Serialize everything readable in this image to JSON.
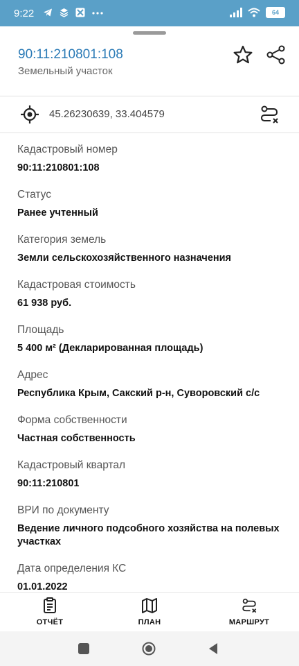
{
  "status_bar": {
    "time": "9:22",
    "left_icons": [
      "telegram-icon",
      "stack-icon",
      "app-icon",
      "more-dots-icon"
    ],
    "right_icons": [
      "signal-icon",
      "wifi-icon"
    ],
    "battery": "64"
  },
  "header": {
    "title": "90:11:210801:108",
    "subtitle": "Земельный участок"
  },
  "coordinates": "45.26230639, 33.404579",
  "details": [
    {
      "label": "Кадастровый номер",
      "value": "90:11:210801:108"
    },
    {
      "label": "Статус",
      "value": "Ранее учтенный"
    },
    {
      "label": "Категория земель",
      "value": "Земли сельскохозяйственного назначения"
    },
    {
      "label": "Кадастровая стоимость",
      "value": "61 938 руб."
    },
    {
      "label": "Площадь",
      "value": "5 400 м² (Декларированная площадь)"
    },
    {
      "label": "Адрес",
      "value": "Республика Крым, Сакский р-н, Суворовский с/с"
    },
    {
      "label": "Форма собственности",
      "value": "Частная собственность"
    },
    {
      "label": "Кадастровый квартал",
      "value": "90:11:210801"
    },
    {
      "label": "ВРИ по документу",
      "value": "Ведение личного подсобного хозяйства на полевых участках"
    },
    {
      "label": "Дата определения КС",
      "value": "01.01.2022"
    }
  ],
  "bottom_nav": [
    {
      "label": "ОТЧЁТ",
      "icon": "report-icon"
    },
    {
      "label": "ПЛАН",
      "icon": "map-icon"
    },
    {
      "label": "МАРШРУТ",
      "icon": "route-icon"
    }
  ],
  "colors": {
    "status_bar": "#5aa0c8",
    "accent": "#2a7ab6"
  }
}
